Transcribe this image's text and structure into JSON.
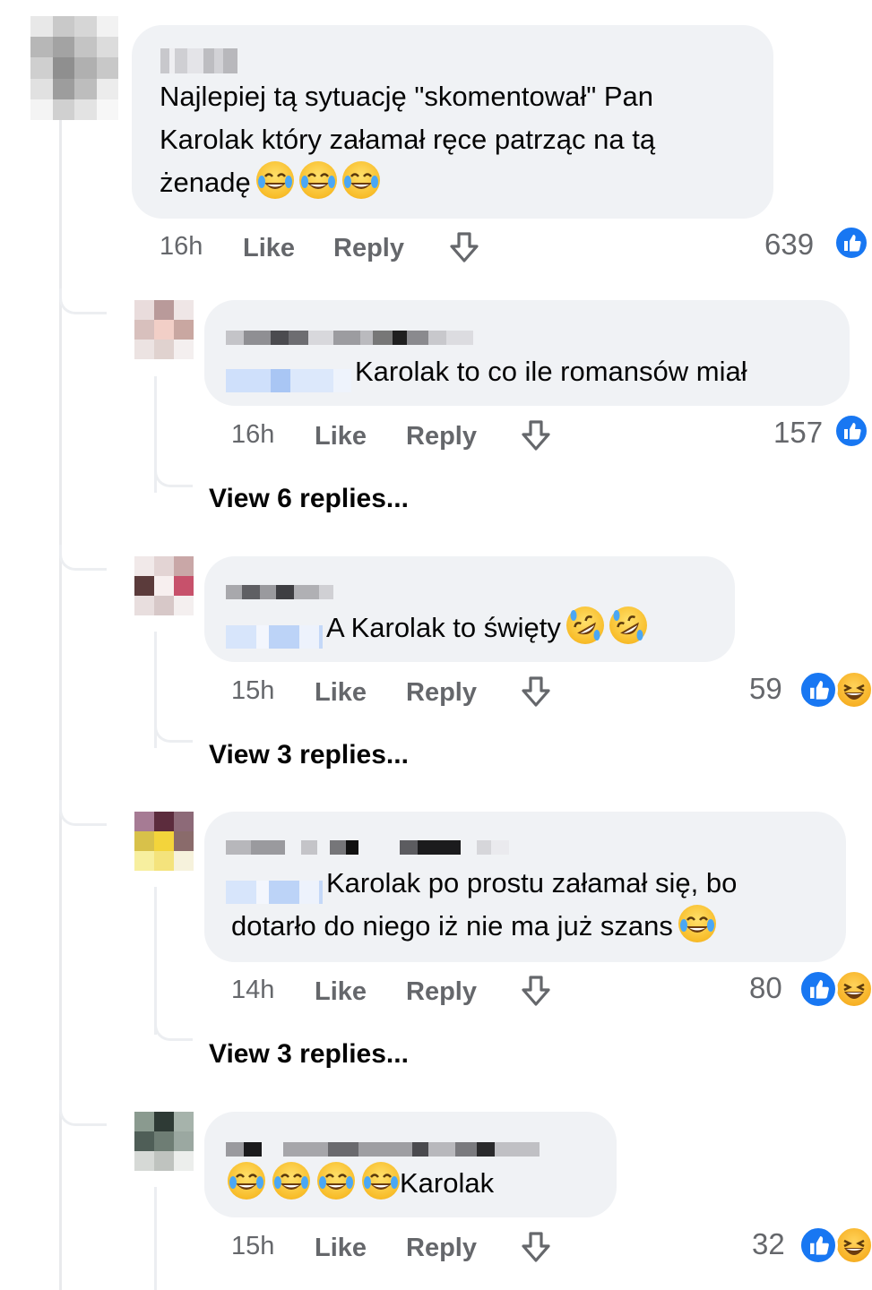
{
  "comments": [
    {
      "text_lines": [
        "Najlepiej tą sytuację \"skomentował\" Pan",
        "Karolak który załamał ręce patrząc na tą",
        "żenadę"
      ],
      "trailing_emoji": [
        "laughing-tears",
        "laughing-tears",
        "laughing-tears"
      ],
      "time": "16h",
      "like": "Like",
      "reply": "Reply",
      "count": "639",
      "reactions": [
        "like"
      ]
    },
    {
      "text_lines": [
        "Karolak to co ile romansów miał"
      ],
      "time": "16h",
      "like": "Like",
      "reply": "Reply",
      "count": "157",
      "reactions": [
        "like"
      ],
      "view_replies": "View 6 replies..."
    },
    {
      "text_lines": [
        "A Karolak to święty"
      ],
      "trailing_emoji": [
        "rofl",
        "rofl"
      ],
      "time": "15h",
      "like": "Like",
      "reply": "Reply",
      "count": "59",
      "reactions": [
        "like",
        "haha"
      ],
      "view_replies": "View 3 replies..."
    },
    {
      "text_lines": [
        "Karolak po prostu załamał się, bo",
        "dotarło do niego iż nie ma już szans"
      ],
      "trailing_emoji": [
        "laughing-tears"
      ],
      "time": "14h",
      "like": "Like",
      "reply": "Reply",
      "count": "80",
      "reactions": [
        "like",
        "haha"
      ],
      "view_replies": "View 3 replies..."
    },
    {
      "leading_emoji": [
        "laughing-tears",
        "laughing-tears",
        "laughing-tears",
        "laughing-tears"
      ],
      "text_lines": [
        "Karolak"
      ],
      "time": "15h",
      "like": "Like",
      "reply": "Reply",
      "count": "32",
      "reactions": [
        "like",
        "haha"
      ]
    }
  ],
  "colors": {
    "bubble": "#f0f2f5",
    "meta": "#65676b",
    "like_blue": "#1877f2"
  }
}
